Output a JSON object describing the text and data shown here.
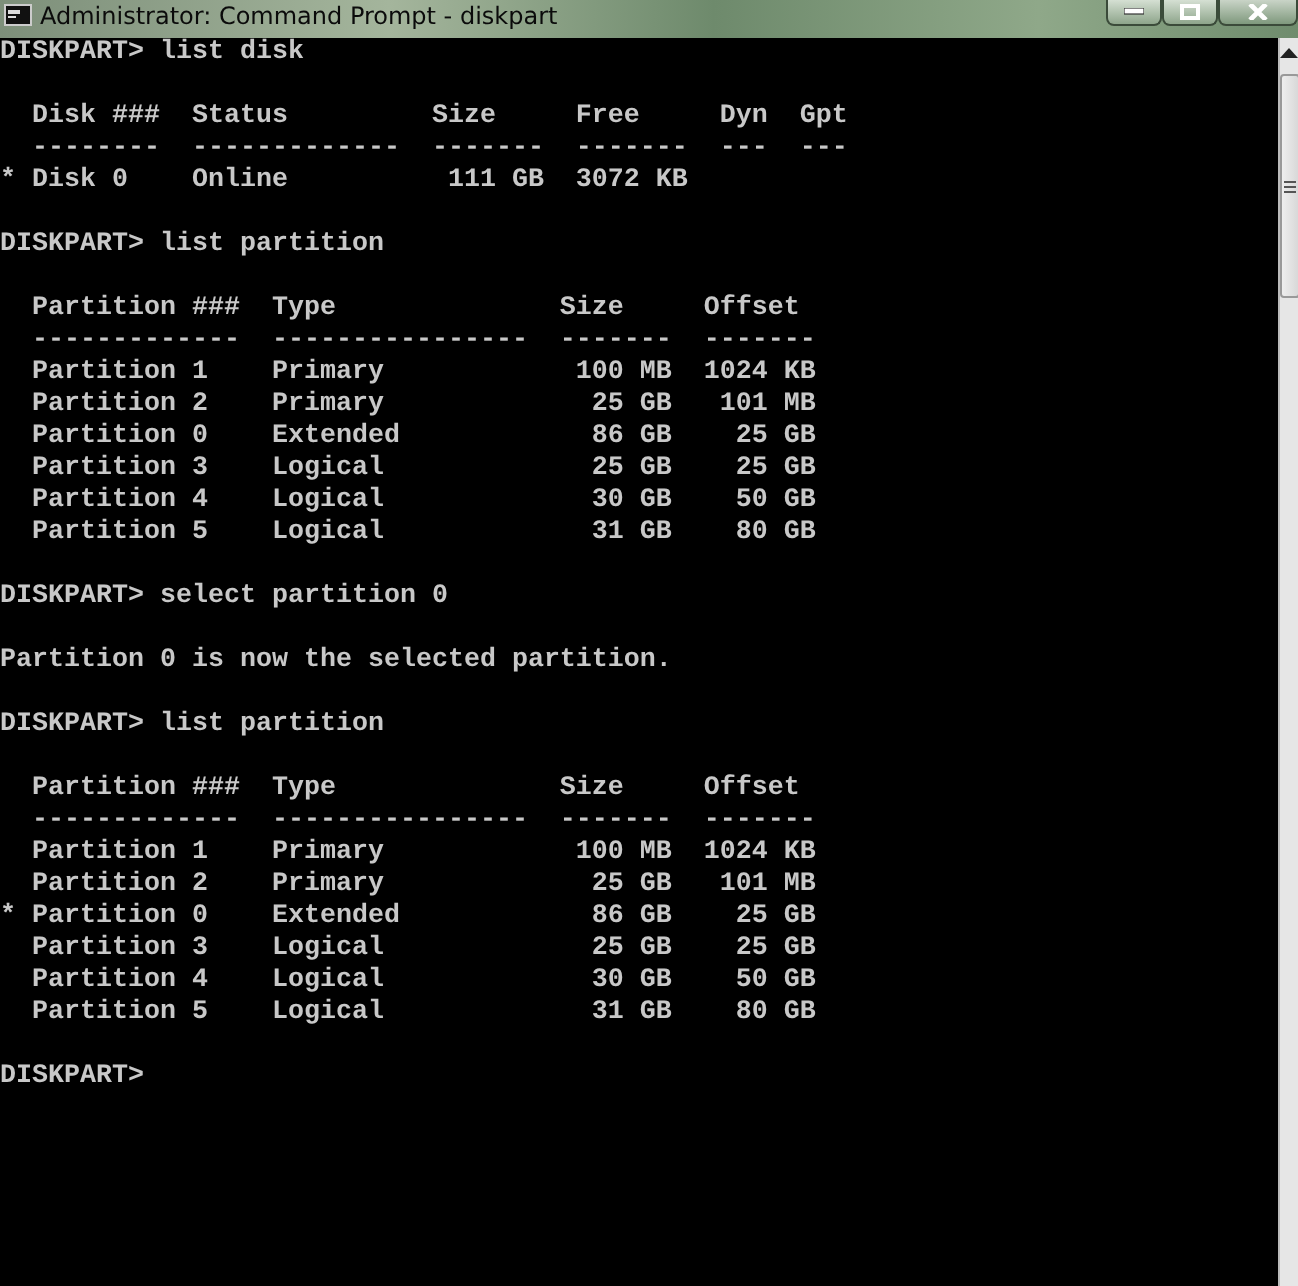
{
  "window": {
    "title": "Administrator: Command Prompt - diskpart"
  },
  "console": {
    "groups": [
      [
        "DISKPART> list disk"
      ],
      [
        "  Disk ###  Status         Size     Free     Dyn  Gpt",
        "  --------  -------------  -------  -------  ---  ---",
        "* Disk 0    Online          111 GB  3072 KB"
      ],
      [
        "DISKPART> list partition"
      ],
      [
        "  Partition ###  Type              Size     Offset",
        "  -------------  ----------------  -------  -------",
        "  Partition 1    Primary            100 MB  1024 KB",
        "  Partition 2    Primary             25 GB   101 MB",
        "  Partition 0    Extended            86 GB    25 GB",
        "  Partition 3    Logical             25 GB    25 GB",
        "  Partition 4    Logical             30 GB    50 GB",
        "  Partition 5    Logical             31 GB    80 GB"
      ],
      [
        "DISKPART> select partition 0"
      ],
      [
        "Partition 0 is now the selected partition."
      ],
      [
        "DISKPART> list partition"
      ],
      [
        "  Partition ###  Type              Size     Offset",
        "  -------------  ----------------  -------  -------",
        "  Partition 1    Primary            100 MB  1024 KB",
        "  Partition 2    Primary             25 GB   101 MB",
        "* Partition 0    Extended            86 GB    25 GB",
        "  Partition 3    Logical             25 GB    25 GB",
        "  Partition 4    Logical             30 GB    50 GB",
        "  Partition 5    Logical             31 GB    80 GB"
      ],
      [
        "DISKPART>"
      ]
    ]
  }
}
